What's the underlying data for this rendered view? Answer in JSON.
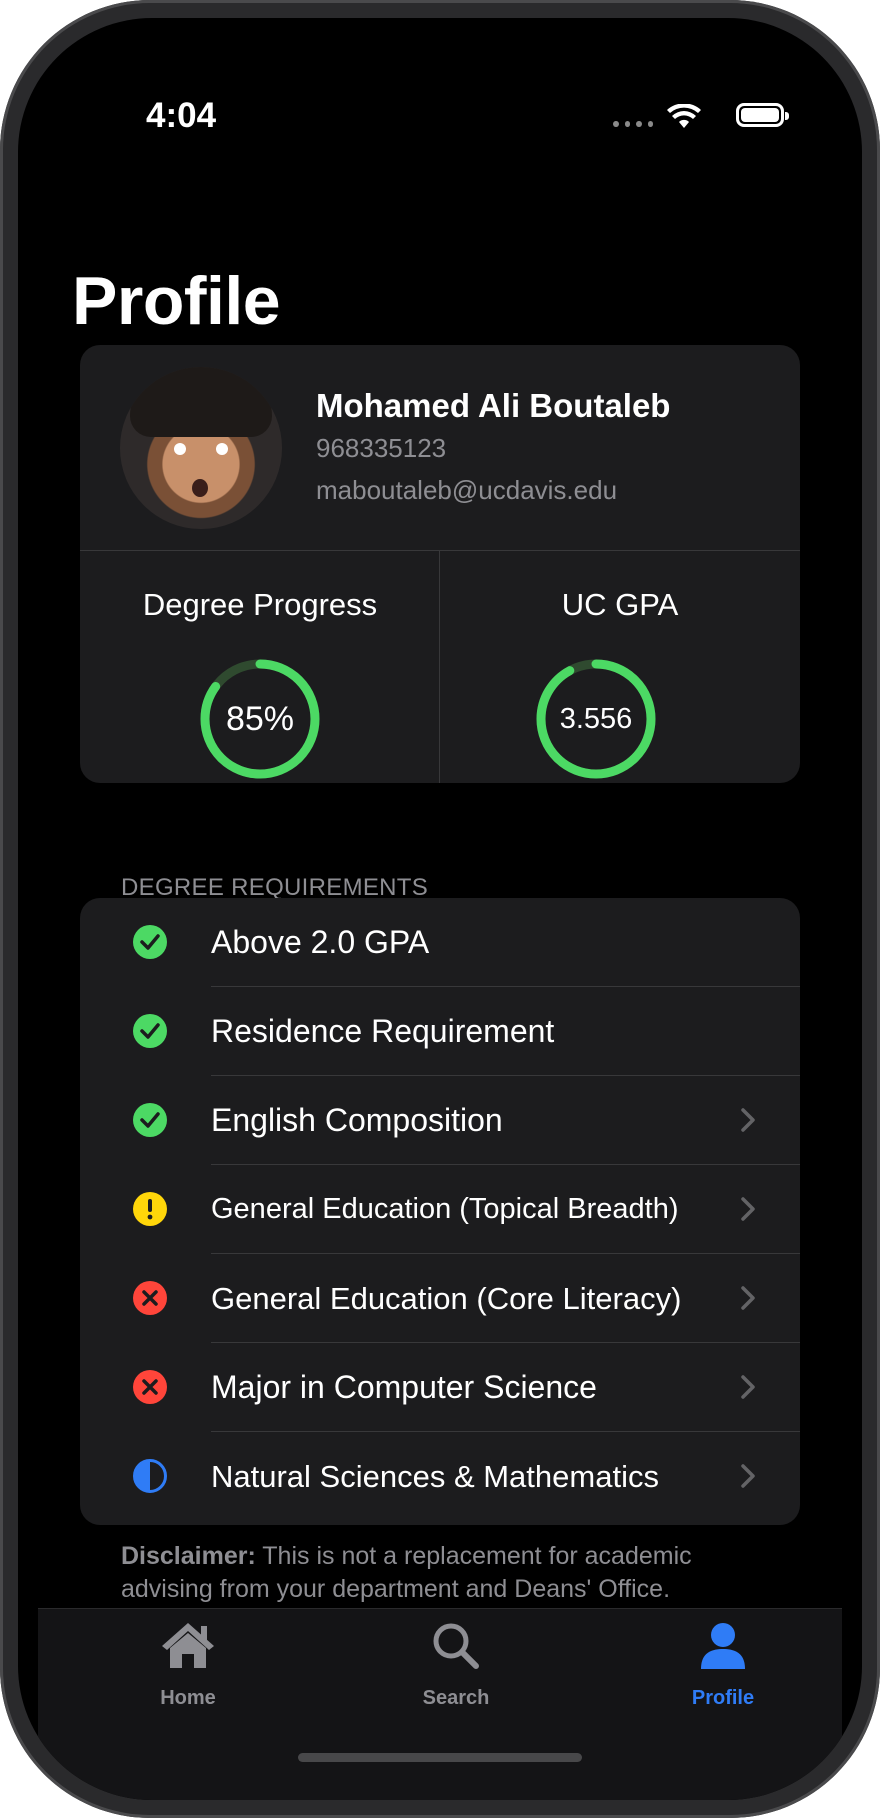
{
  "status_bar": {
    "time": "4:04"
  },
  "page": {
    "title": "Profile"
  },
  "profile": {
    "name": "Mohamed Ali Boutaleb",
    "student_id": "968335123",
    "email": "maboutaleb@ucdavis.edu"
  },
  "stats": {
    "degree_progress": {
      "label": "Degree Progress",
      "value": "85%",
      "fraction": 0.85,
      "color": "#4cd964"
    },
    "gpa": {
      "label": "UC GPA",
      "value": "3.556",
      "fraction": 0.92,
      "color": "#4cd964"
    }
  },
  "requirements": {
    "header": "DEGREE REQUIREMENTS",
    "items": [
      {
        "label": "Above 2.0 GPA",
        "status": "complete",
        "icon": "checkmark-circle-icon",
        "has_chevron": false
      },
      {
        "label": "Residence Requirement",
        "status": "complete",
        "icon": "checkmark-circle-icon",
        "has_chevron": false
      },
      {
        "label": "English Composition",
        "status": "complete",
        "icon": "checkmark-circle-icon",
        "has_chevron": true
      },
      {
        "label": "General Education (Topical Breadth)",
        "status": "warning",
        "icon": "exclamation-circle-icon",
        "has_chevron": true
      },
      {
        "label": "General Education (Core Literacy)",
        "status": "incomplete",
        "icon": "xmark-circle-icon",
        "has_chevron": true
      },
      {
        "label": "Major in Computer Science",
        "status": "incomplete",
        "icon": "xmark-circle-icon",
        "has_chevron": true
      },
      {
        "label": "Natural Sciences & Mathematics",
        "status": "in-progress",
        "icon": "half-circle-icon",
        "has_chevron": true
      }
    ]
  },
  "disclaimer": {
    "bold": "Disclaimer:",
    "text": " This is not a replacement for academic advising from your department and Deans' Office."
  },
  "tabbar": {
    "items": [
      {
        "label": "Home",
        "icon": "house-icon",
        "active": false
      },
      {
        "label": "Search",
        "icon": "magnifying-glass-icon",
        "active": false
      },
      {
        "label": "Profile",
        "icon": "person-icon",
        "active": true
      }
    ]
  },
  "colors": {
    "accent": "#2f7cf6",
    "complete": "#4cd964",
    "warning": "#ffd60a",
    "incomplete": "#ff453a",
    "in_progress": "#2f7cf6",
    "card_bg": "#1c1c1e",
    "secondary_text": "#8e8e93"
  }
}
